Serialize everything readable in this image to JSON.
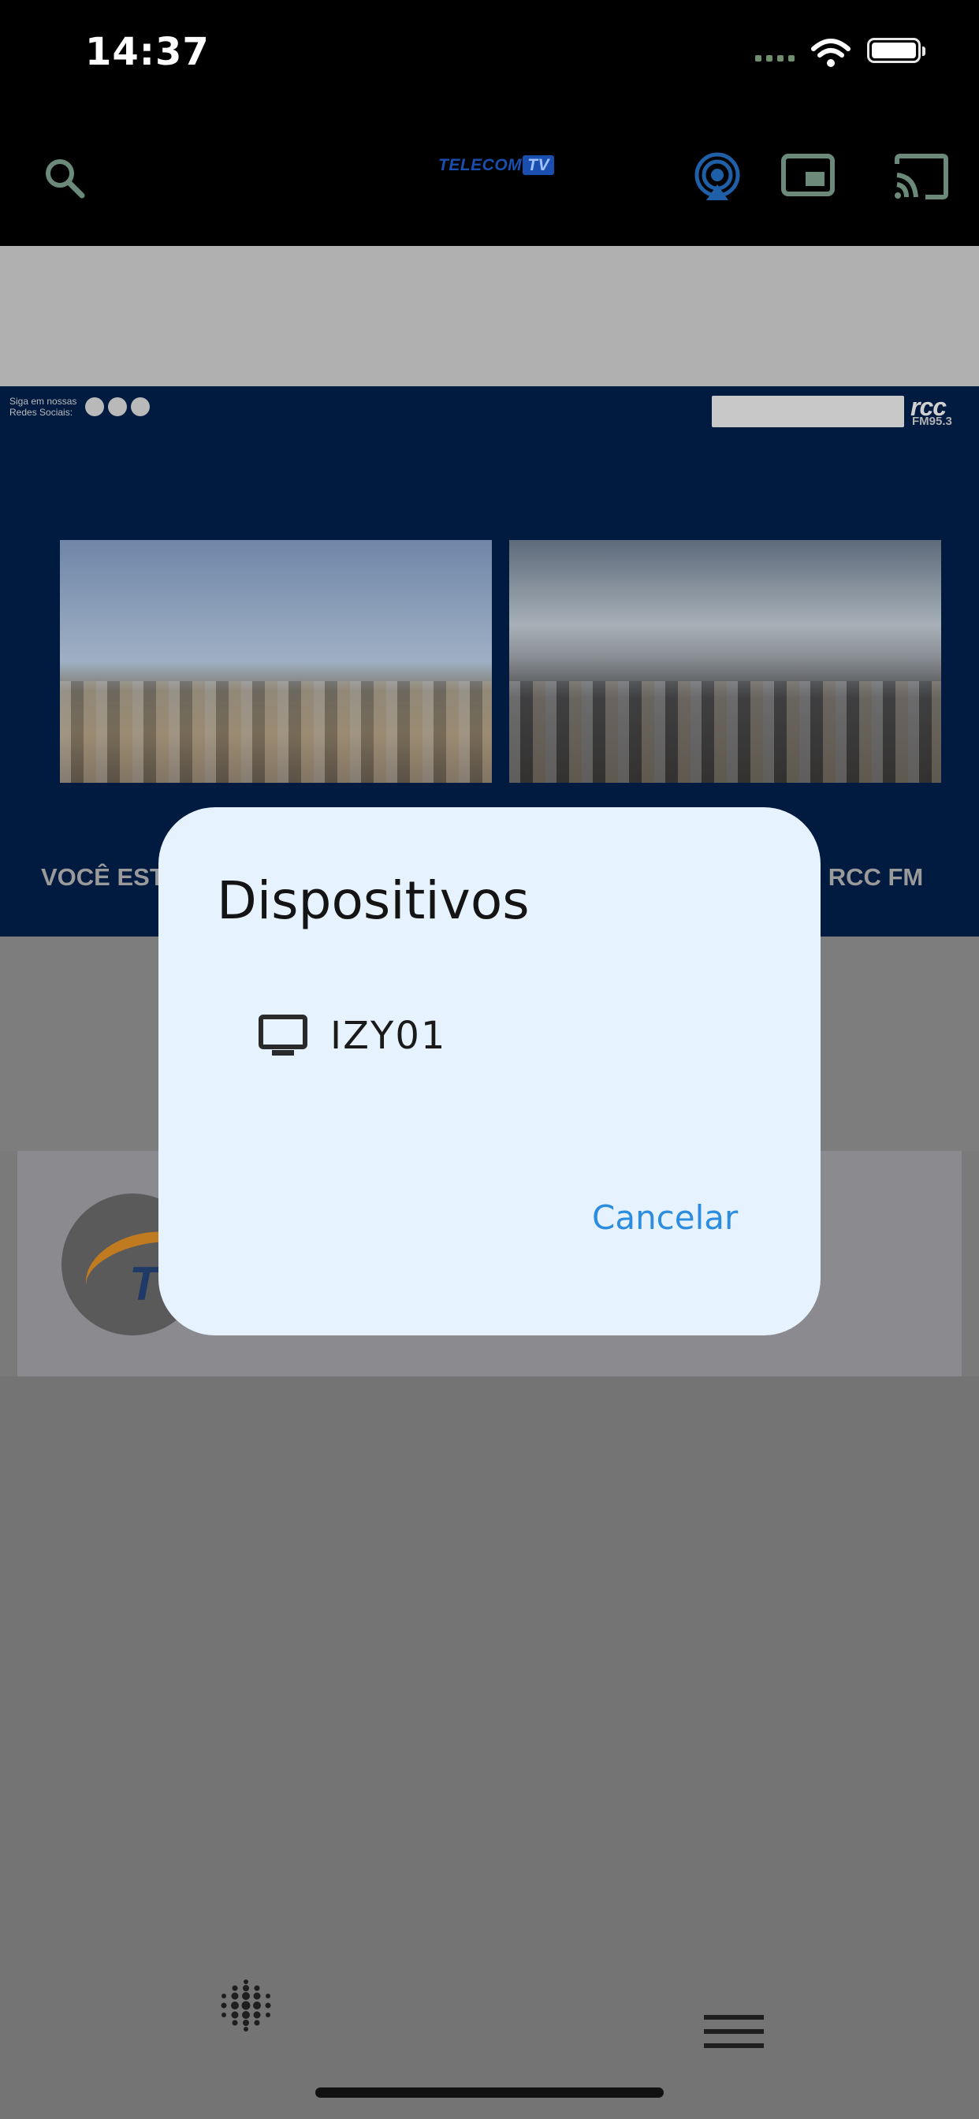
{
  "status_bar": {
    "time": "14:37"
  },
  "app_bar": {
    "logo_text": "TELECOM",
    "logo_badge": "TV"
  },
  "banner": {
    "social_text_line1": "Siga em nossas",
    "social_text_line2": "Redes Sociais:",
    "brand_logo": "rcc",
    "brand_sub": "FM95.3",
    "caption_left": "VOCÊ EST",
    "caption_right": "O RCC FM"
  },
  "dialog": {
    "title": "Dispositivos",
    "devices": [
      {
        "name": "IZY01",
        "icon": "tv-icon"
      }
    ],
    "cancel_label": "Cancelar"
  },
  "colors": {
    "accent": "#2b8ce0",
    "dialog_bg": "#e6f2fd",
    "banner_bg": "#001a40"
  }
}
